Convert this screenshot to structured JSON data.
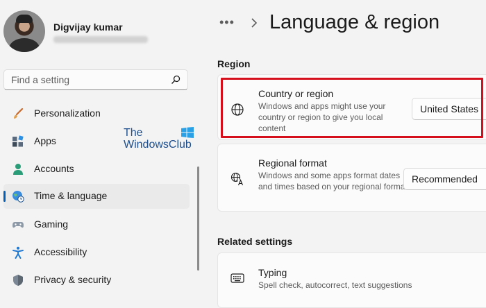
{
  "user": {
    "name": "Digvijay kumar",
    "email": "digvijay####@gmail.com"
  },
  "search": {
    "placeholder": "Find a setting"
  },
  "sidebar": {
    "items": [
      {
        "label": "Personalization",
        "icon": "brush-icon"
      },
      {
        "label": "Apps",
        "icon": "apps-icon"
      },
      {
        "label": "Accounts",
        "icon": "person-icon"
      },
      {
        "label": "Time & language",
        "icon": "globe-clock-icon",
        "selected": true
      },
      {
        "label": "Gaming",
        "icon": "gamepad-icon"
      },
      {
        "label": "Accessibility",
        "icon": "accessibility-icon"
      },
      {
        "label": "Privacy & security",
        "icon": "shield-icon"
      }
    ]
  },
  "watermark": {
    "line1": "The",
    "line2": "WindowsClub"
  },
  "header": {
    "more": "•••",
    "title": "Language & region"
  },
  "region": {
    "section_title": "Region",
    "country": {
      "title": "Country or region",
      "description": "Windows and apps might use your country or region to give you local content",
      "value": "United States"
    },
    "format": {
      "title": "Regional format",
      "description": "Windows and some apps format dates and times based on your regional format",
      "value": "Recommended"
    }
  },
  "related": {
    "section_title": "Related settings",
    "typing": {
      "title": "Typing",
      "description": "Spell check, autocorrect, text suggestions"
    }
  },
  "colors": {
    "accent": "#005fb8",
    "highlight": "#d50f1c",
    "watermark": "#1e4e8c"
  }
}
